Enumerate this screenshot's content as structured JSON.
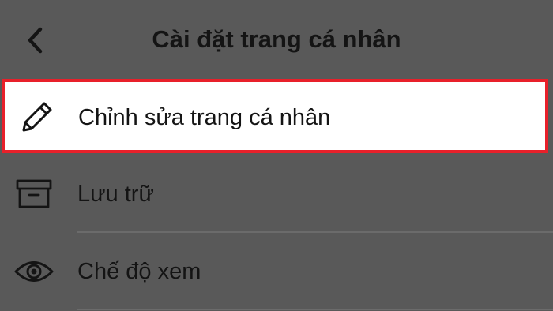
{
  "header": {
    "title": "Cài đặt trang cá nhân",
    "back_icon": "chevron-left-icon"
  },
  "items": [
    {
      "label": "Chỉnh sửa trang cá nhân",
      "icon": "pencil-icon",
      "highlighted": true
    },
    {
      "label": "Lưu trữ",
      "icon": "archive-box-icon",
      "highlighted": false
    },
    {
      "label": "Chế độ xem",
      "icon": "eye-icon",
      "highlighted": false
    }
  ],
  "colors": {
    "background": "#595959",
    "highlight_border": "#e8202a",
    "highlight_fill": "#ffffff",
    "text": "#141414",
    "divider": "#6b6b6b"
  }
}
